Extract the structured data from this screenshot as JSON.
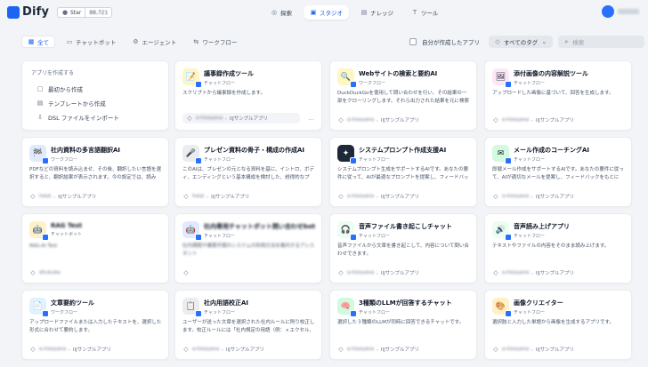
{
  "header": {
    "logo": "Dify",
    "star_label": "Star",
    "star_count": "88,721",
    "nav": [
      {
        "label": "探索",
        "icon": "compass-icon"
      },
      {
        "label": "スタジオ",
        "icon": "studio-icon",
        "active": true
      },
      {
        "label": "ナレッジ",
        "icon": "book-icon"
      },
      {
        "label": "ツール",
        "icon": "tool-icon"
      }
    ]
  },
  "tabs": [
    {
      "label": "全て",
      "active": true
    },
    {
      "label": "チャットボット"
    },
    {
      "label": "エージェント"
    },
    {
      "label": "ワークフロー"
    }
  ],
  "filters": {
    "created_by_me": "自分が作成したアプリ",
    "all_tags": "すべてのタグ",
    "search_placeholder": "検索"
  },
  "create": {
    "title": "アプリを作成する",
    "items": [
      "最初から作成",
      "テンプレートから作成",
      "DSL ファイルをインポート"
    ]
  },
  "apps": [
    {
      "name": "議事録作成ツール",
      "type": "チャットフロー",
      "desc": "スクリプトから議事録を作成します。",
      "tags": "IIJサンプルアプリ",
      "blurred_tag": "a-hisoyana",
      "icon_bg": "#fdf6c3",
      "glyph": "📝"
    },
    {
      "name": "Webサイトの検索と要約AI",
      "type": "ワークフロー",
      "desc": "DuckDuckGoを使用して問い合わせを行い、その結果の一部をクローリングします。それら出力された結果を元に検索結…",
      "tags": "IIJサンプルアプリ",
      "blurred_tag": "a-hisoyana",
      "icon_bg": "#fef7c3",
      "glyph": "🔍"
    },
    {
      "name": "添付画像の内容解説ツール",
      "type": "チャットフロー",
      "desc": "アップロードした画像に基づいて、回答を生成します。",
      "tags": "IIJサンプルアプリ",
      "blurred_tag": "a-hisoyana",
      "icon_bg": "#fce7f6",
      "glyph": "🖼"
    },
    {
      "name": "社内資料の多言語翻訳AI",
      "type": "ワークフロー",
      "desc": "PDFなどの資料を読み込ませ、その後、翻訳したい言語を選択すると、翻訳結果が表示されます。今の設定では、読み込…",
      "tags": "IIJサンプルアプリ",
      "blurred_tag": "fukai",
      "icon_bg": "#e0eaff",
      "glyph": "🏁"
    },
    {
      "name": "プレゼン資料の骨子・構成の作成AI",
      "type": "チャットフロー",
      "desc": "このAIは、プレゼンの元となる資料を基に、イントロ、ボディ、エンディングという基本構成を検討した、説得的なプレ…",
      "tags": "IIJサンプルアプリ",
      "blurred_tag": "fukai",
      "icon_bg": "#eaecf0",
      "glyph": "🎤"
    },
    {
      "name": "システムプロンプト作成支援AI",
      "type": "チャットフロー",
      "desc": "システムプロンプト生成をサポートするAIです。あなたの要件に従って、AIが最適なプロンプトを提案し、フィードバック…",
      "tags": "IIJサンプルアプリ",
      "blurred_tag": "a-hisoyana",
      "icon_bg": "#1d2939",
      "glyph": "✦"
    },
    {
      "name": "メール作成のコーチングAI",
      "type": "チャットフロー",
      "desc": "即戦メール作成をサポートするAIです。あなたの要件に従って、AIが適切なメールを提案し、フィードバックをもとに随…",
      "tags": "IIJサンプルアプリ",
      "blurred_tag": "a-hisoyana",
      "icon_bg": "#d1fadf",
      "glyph": "✉"
    },
    {
      "name": "RAG Test",
      "type": "チャットボット",
      "desc": "RAG-Ai Test",
      "tags": "",
      "blurred_tag": "dhukube",
      "icon_bg": "#fef0c7",
      "glyph": "🤖"
    },
    {
      "name": "社内専用チャットボット問い合わせbot",
      "type": "チャットフロー",
      "desc": "社内規程や業務手順のシステムの利用方法を案内するアシスタント",
      "tags": "",
      "blurred_tag": "",
      "icon_bg": "#e0eaff",
      "glyph": "🤖"
    },
    {
      "name": "音声ファイル書き起こしチャット",
      "type": "チャットフロー",
      "desc": "音声ファイルから文章を書き起こして、内容について問い合わせできます。",
      "tags": "IIJサンプルアプリ",
      "blurred_tag": "a-hisoyana",
      "icon_bg": "#ecfdf3",
      "glyph": "🎧"
    },
    {
      "name": "音声読み上げアプリ",
      "type": "チャットフロー",
      "desc": "テキストやファイルの内容をそのまま読み上げます。",
      "tags": "IIJサンプルアプリ",
      "blurred_tag": "a-hisoyana",
      "icon_bg": "#ecfdf3",
      "glyph": "🔊"
    },
    {
      "name": "文章要約ツール",
      "type": "ワークフロー",
      "desc": "アップロードファイルまたは入力したテキストを、選択した形式に合わせて要約します。",
      "tags": "IIJサンプルアプリ",
      "blurred_tag": "a-hisoyana",
      "icon_bg": "#e0f2fe",
      "glyph": "📄"
    },
    {
      "name": "社内用語校正AI",
      "type": "チャットフロー",
      "desc": "ユーザーが送った文章を選択された社内ルールに則り校正します。校正ルールには「社内規定の用語（例：ｘエクセル、◯…",
      "tags": "IIJサンプルアプリ",
      "blurred_tag": "a-hisoyana",
      "icon_bg": "#eaecf0",
      "glyph": "📋"
    },
    {
      "name": "3種類のLLMが回答するチャット",
      "type": "チャットフロー",
      "desc": "選択した３種類のLLMが同時に回答できるチャットです。",
      "tags": "IIJサンプルアプリ",
      "blurred_tag": "a-hisoyana",
      "icon_bg": "#d1fadf",
      "glyph": "🧠"
    },
    {
      "name": "画像クリエイター",
      "type": "チャットフロー",
      "desc": "選択肢と入力した単語から画像を生成するアプリです。",
      "tags": "IIJサンプルアプリ",
      "blurred_tag": "a-hisoyana",
      "icon_bg": "#fef0c7",
      "glyph": "🎨"
    }
  ]
}
